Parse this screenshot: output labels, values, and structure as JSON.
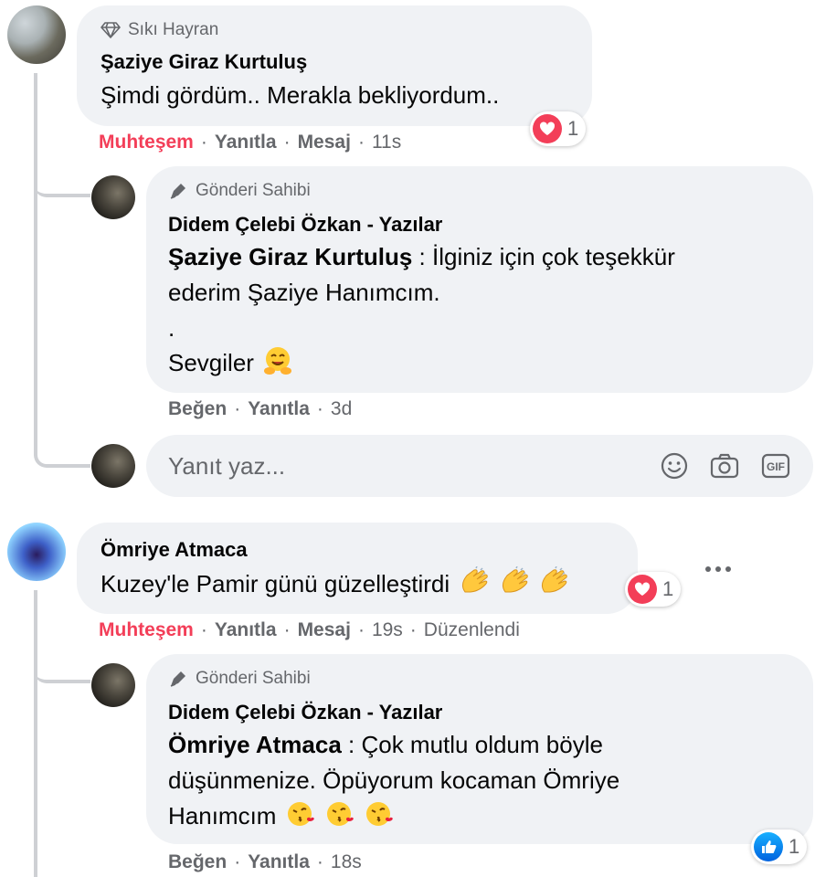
{
  "comments": [
    {
      "badge": "Sıkı Hayran",
      "author": "Şaziye Giraz Kurtuluş",
      "text": "Şimdi gördüm.. Merakla bekliyordum..",
      "reaction_count": "1",
      "actions": {
        "react": "Muhteşem",
        "reply": "Yanıtla",
        "message": "Mesaj",
        "time": "11s"
      },
      "reply": {
        "badge": "Gönderi Sahibi",
        "author": "Didem Çelebi Özkan - Yazılar",
        "mention": "Şaziye Giraz Kurtuluş",
        "line1_rest": " : İlginiz için çok teşekkür",
        "line2": "ederim Şaziye Hanımcım.",
        "line3": ".",
        "line4": "Sevgiler",
        "actions": {
          "like": "Beğen",
          "reply": "Yanıtla",
          "time": "3d"
        }
      },
      "reply_input": {
        "placeholder": "Yanıt yaz..."
      }
    },
    {
      "author": "Ömriye Atmaca",
      "text": "Kuzey'le Pamir günü güzelleştirdi",
      "reaction_count": "1",
      "actions": {
        "react": "Muhteşem",
        "reply": "Yanıtla",
        "message": "Mesaj",
        "time": "19s",
        "edited": "Düzenlendi"
      },
      "reply": {
        "badge": "Gönderi Sahibi",
        "author": "Didem Çelebi Özkan - Yazılar",
        "mention": "Ömriye Atmaca",
        "line1_rest": " : Çok mutlu oldum böyle",
        "line2": "düşünmenize. Öpüyorum kocaman Ömriye",
        "line3": "Hanımcım",
        "reaction_count": "1",
        "actions": {
          "like": "Beğen",
          "reply": "Yanıtla",
          "time": "18s"
        }
      }
    }
  ],
  "colors": {
    "love": "#f33e58",
    "muted": "#65676b",
    "bubble": "#f0f2f5",
    "like_blue": "#0866ff"
  },
  "icons": [
    "diamond-icon",
    "pen-icon",
    "heart-reaction-icon",
    "like-reaction-icon",
    "smiley-icon",
    "camera-icon",
    "gif-icon",
    "more-icon"
  ]
}
